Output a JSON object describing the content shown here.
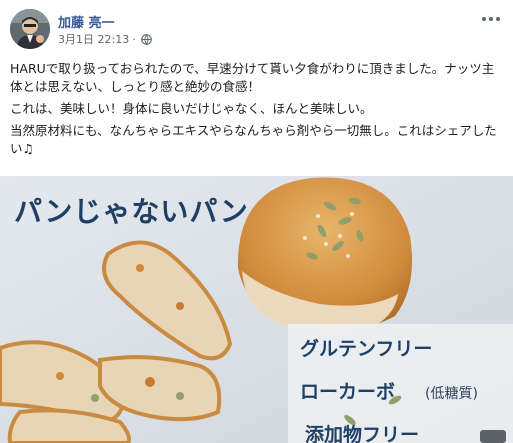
{
  "post": {
    "author": "加藤 亮一",
    "date": "3月1日 22:13",
    "separator": "·",
    "privacy_icon": "globe-icon",
    "options_icon": "more-options-icon",
    "paragraphs": [
      "HARUで取り扱っておられたので、早速分けて貰い夕食がわりに頂きました。ナッツ主体とは思えない、しっとり感と絶妙の食感！",
      "これは、美味しい！身体に良いだけじゃなく、ほんと美味しい。",
      "当然原材料にも、なんちゃらエキスやらなんちゃら剤やら一切無し。これはシェアしたい♫"
    ]
  },
  "photo": {
    "headline": "パンじゃないパン",
    "features": {
      "gluten_free": "グルテンフリー",
      "low_carb": "ローカーボ",
      "low_carb_note": "(低糖質)",
      "additive_free": "添加物フリー"
    }
  },
  "colors": {
    "author_link": "#385898",
    "meta_gray": "#616770",
    "headline_navy": "#1f3f66",
    "bread_crust": "#d38a3a",
    "bread_crumb": "#ead9bf"
  }
}
